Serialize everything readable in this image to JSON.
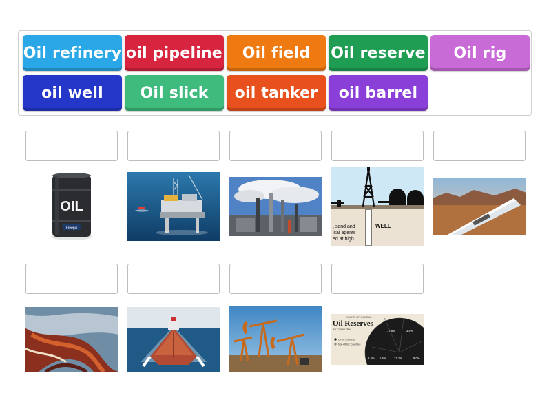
{
  "tiles": [
    {
      "label": "Oil refinery",
      "color": "#2aa7e6"
    },
    {
      "label": "oil pipeline",
      "color": "#d8253f"
    },
    {
      "label": "Oil field",
      "color": "#f07a12"
    },
    {
      "label": "Oil reserve",
      "color": "#1f9e53"
    },
    {
      "label": "Oil rig",
      "color": "#c86bd6"
    },
    {
      "label": "oil well",
      "color": "#2537c9"
    },
    {
      "label": "Oil slick",
      "color": "#3fbc7d"
    },
    {
      "label": "oil tanker",
      "color": "#e8501d"
    },
    {
      "label": "oil barrel",
      "color": "#8a3fd8"
    }
  ],
  "images": {
    "barrel": {
      "text": "OIL",
      "brand": "Freepik",
      "icon": "oil-barrel-image"
    },
    "rig": {
      "icon": "offshore-oil-rig-image"
    },
    "refinery": {
      "icon": "oil-refinery-image"
    },
    "well": {
      "label": "WELL",
      "caption_lines": [
        ", sand and",
        "ical agents",
        "ed at high"
      ],
      "icon": "oil-well-diagram-image"
    },
    "pipeline": {
      "icon": "oil-pipeline-image"
    },
    "slick": {
      "icon": "oil-slick-image"
    },
    "tanker": {
      "icon": "oil-tanker-image"
    },
    "field": {
      "icon": "oil-field-pumpjacks-image"
    },
    "reserves": {
      "kicker": "SHARE OF GLOBAL",
      "title": "Oil Reserves",
      "subtitle": "BY COUNTRY",
      "legend": [
        "OPEC Countries",
        "Non-OPEC Countries"
      ],
      "values": [
        "17.8%",
        "3.5%",
        "8.4%",
        "5.6%",
        "17.2%",
        "9.0%"
      ]
    }
  }
}
